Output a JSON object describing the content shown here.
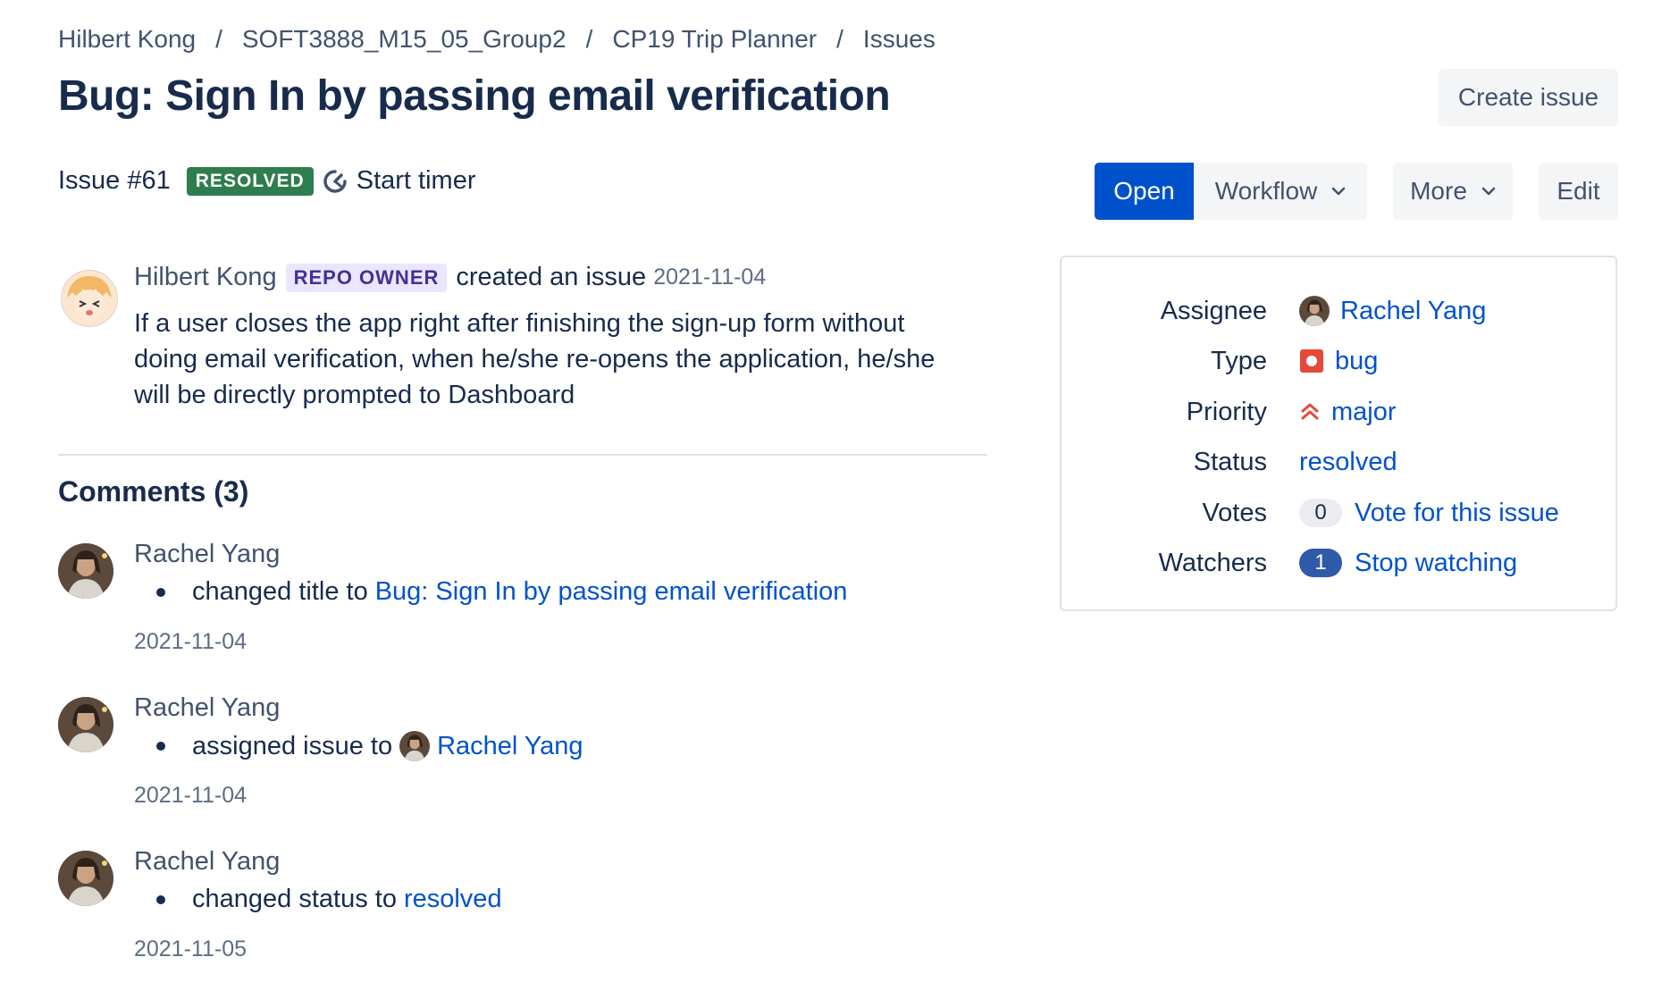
{
  "breadcrumb": [
    {
      "label": "Hilbert Kong"
    },
    {
      "label": "SOFT3888_M15_05_Group2"
    },
    {
      "label": "CP19 Trip Planner"
    },
    {
      "label": "Issues"
    }
  ],
  "breadcrumb_separator": "/",
  "title": "Bug: Sign In by passing email verification",
  "actions": {
    "create_issue": "Create issue",
    "open": "Open",
    "workflow": "Workflow",
    "more": "More",
    "edit": "Edit"
  },
  "issue": {
    "number": "Issue #61",
    "status_lozenge": "RESOLVED",
    "start_timer": "Start timer"
  },
  "creation": {
    "author": "Hilbert Kong",
    "role": "REPO OWNER",
    "action": "created an issue",
    "date": "2021-11-04",
    "description": "If a user closes the app right after finishing the sign-up form without doing email verification, when he/she re-opens the application, he/she will be directly prompted to Dashboard"
  },
  "comments_heading": "Comments (3)",
  "comments": [
    {
      "author": "Rachel Yang",
      "change_text": "changed title to",
      "change_value": "Bug: Sign In by passing email verification",
      "date": "2021-11-04"
    },
    {
      "author": "Rachel Yang",
      "change_text": "assigned issue to",
      "change_value": "Rachel Yang",
      "date": "2021-11-04"
    },
    {
      "author": "Rachel Yang",
      "change_text": "changed status to",
      "change_value": "resolved",
      "date": "2021-11-05"
    }
  ],
  "sidebar": {
    "assignee": {
      "label": "Assignee",
      "value": "Rachel Yang"
    },
    "type": {
      "label": "Type",
      "value": "bug",
      "icon": "bug-icon",
      "icon_color": "#e5493a"
    },
    "priority": {
      "label": "Priority",
      "value": "major",
      "icon": "priority-major-icon",
      "icon_color": "#e5493a"
    },
    "status": {
      "label": "Status",
      "value": "resolved"
    },
    "votes": {
      "label": "Votes",
      "count": "0",
      "action": "Vote for this issue"
    },
    "watchers": {
      "label": "Watchers",
      "count": "1",
      "action": "Stop watching"
    }
  },
  "colors": {
    "primary": "#0052cc",
    "resolved_lozenge": "#2e7d4f",
    "role_lozenge_bg": "#eae6ff",
    "role_lozenge_text": "#403294",
    "text": "#172b4d",
    "subtle_text": "#42526e"
  }
}
